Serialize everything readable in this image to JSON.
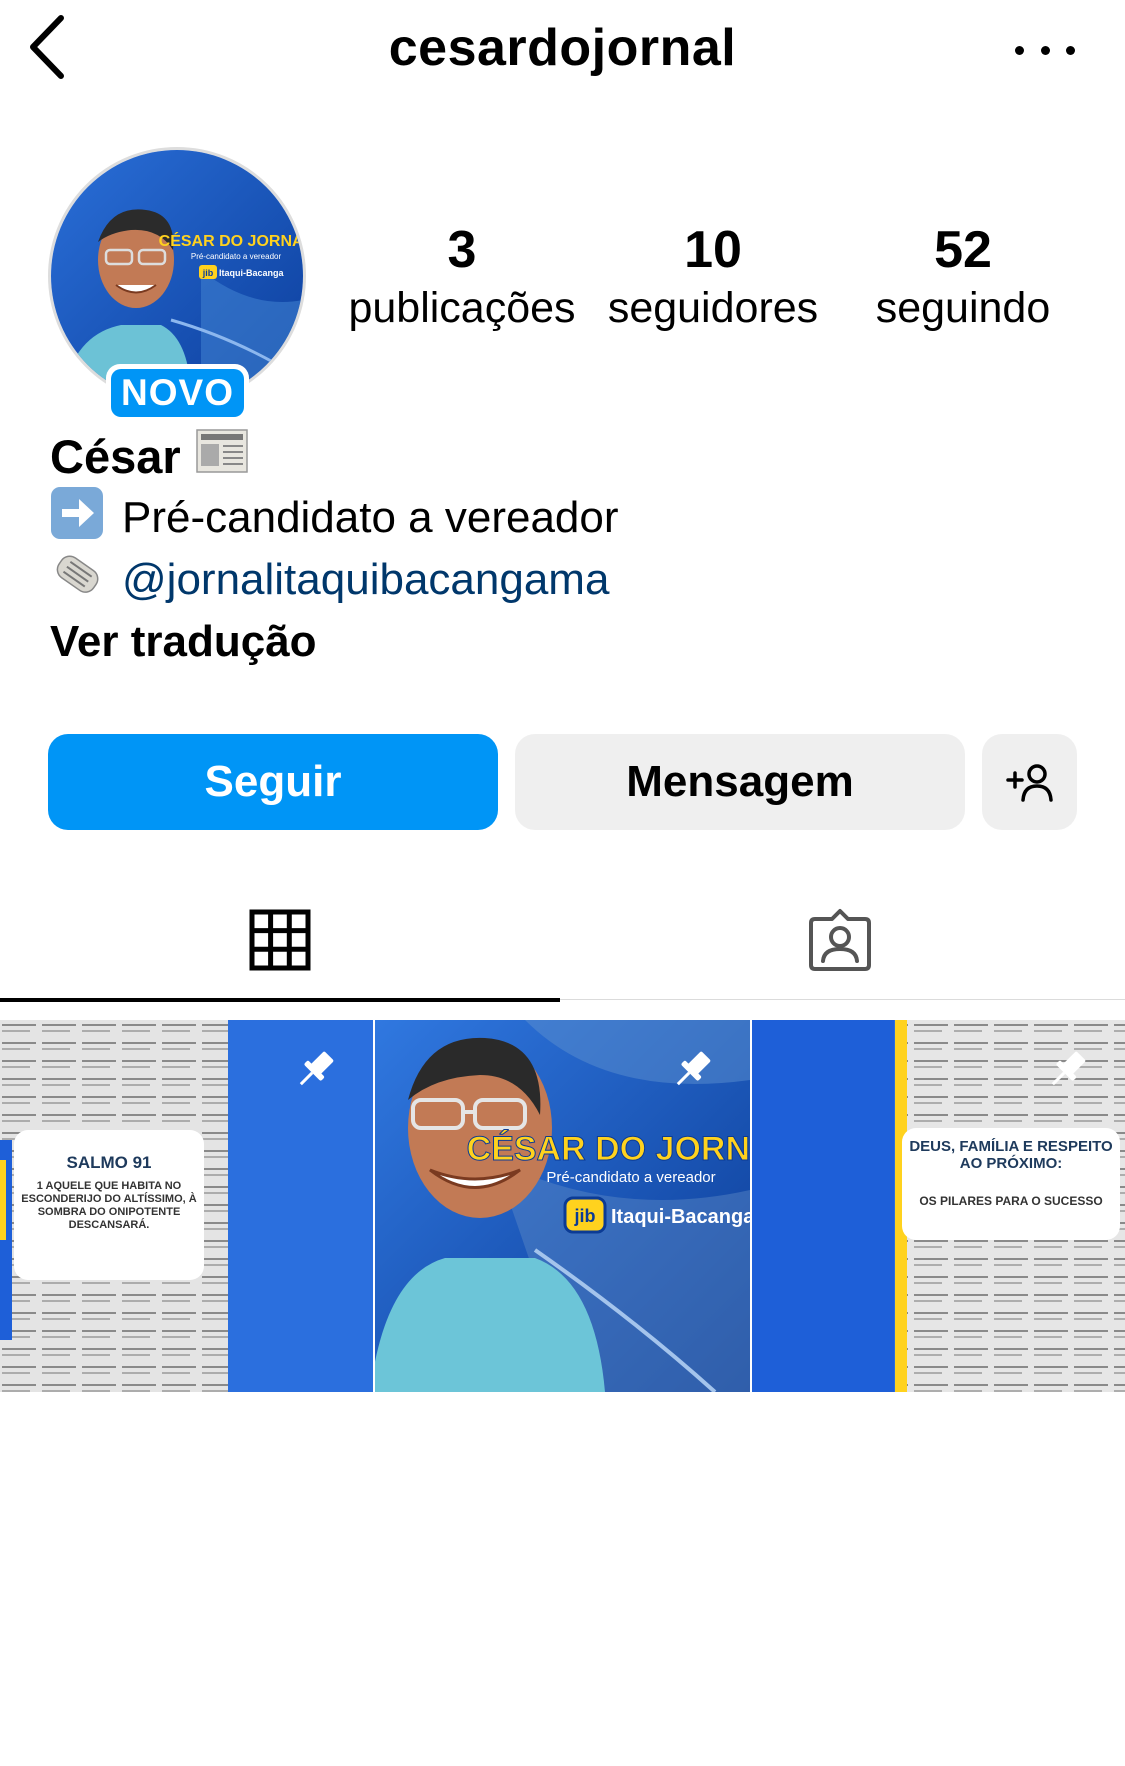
{
  "header": {
    "username": "cesardojornal",
    "back_icon": "chevron-left-icon",
    "more_icon": "more-horizontal-icon"
  },
  "profile": {
    "new_badge": "NOVO",
    "stats": [
      {
        "value": "3",
        "label": "publicações"
      },
      {
        "value": "10",
        "label": "seguidores"
      },
      {
        "value": "52",
        "label": "seguindo"
      }
    ]
  },
  "bio": {
    "name": "César",
    "line1": "Pré-candidato a vereador",
    "link": "@jornalitaquibacangama",
    "translate": "Ver tradução"
  },
  "buttons": {
    "follow": "Seguir",
    "message": "Mensagem",
    "add_user_icon": "add-user-icon"
  },
  "tabs": [
    {
      "icon": "grid-icon",
      "active": true
    },
    {
      "icon": "tagged-icon",
      "active": false
    }
  ],
  "posts": {
    "post1": {
      "title": "SALMO 91",
      "text": "1 AQUELE QUE HABITA NO ESCONDERIJO DO ALTÍSSIMO, À SOMBRA DO ONIPOTENTE DESCANSARÁ."
    },
    "post2": {
      "title": "CÉSAR DO JORNAL",
      "subtitle": "Pré-candidato a vereador",
      "brand": "Itaqui-Bacanga",
      "brand_logo": "jib"
    },
    "post3": {
      "title": "DEUS, FAMÍLIA E RESPEITO AO PRÓXIMO:",
      "text": "OS PILARES PARA O SUCESSO"
    }
  },
  "avatar": {
    "title": "CÉSAR DO JORNAL",
    "subtitle": "Pré-candidato a vereador",
    "brand": "Itaqui-Bacanga",
    "brand_logo": "jib"
  },
  "colors": {
    "accent": "#0095f6",
    "link": "#00376b",
    "button_secondary": "#efefef",
    "poster_yellow": "#ffd21e",
    "poster_blue": "#1e5fd8"
  }
}
